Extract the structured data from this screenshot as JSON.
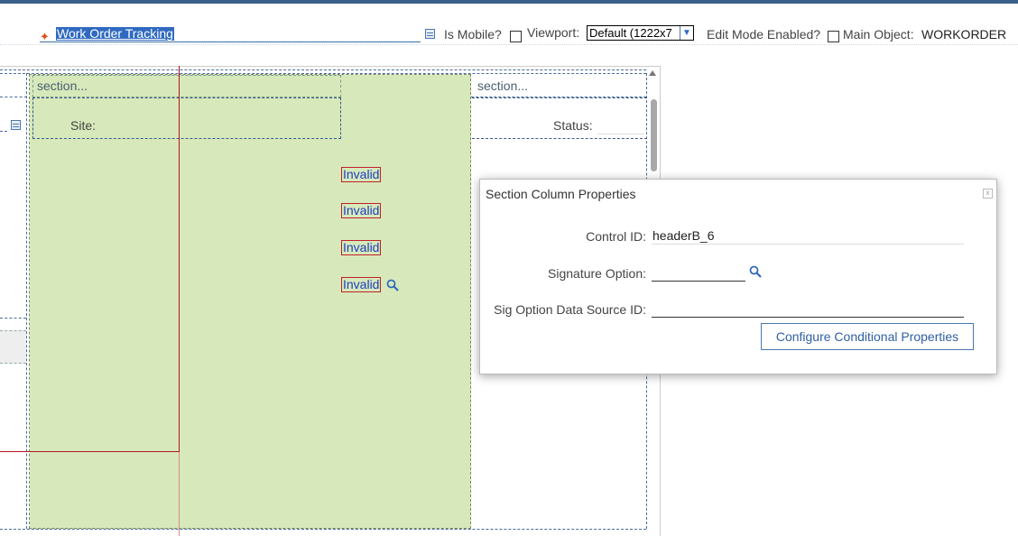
{
  "header": {
    "app_title": "Work Order Tracking",
    "is_mobile_label": "Is Mobile?",
    "viewport_label": "Viewport:",
    "viewport_value": "Default (1222x7",
    "edit_mode_label": "Edit Mode Enabled?",
    "main_object_label": "Main Object:",
    "main_object_value": "WORKORDER"
  },
  "canvas": {
    "section_left_label": "section...",
    "section_right_label": "section...",
    "site_label": "Site:",
    "status_label": "Status:",
    "invalid_items": [
      "Invalid",
      "Invalid",
      "Invalid",
      "Invalid"
    ]
  },
  "dialog": {
    "title": "Section Column Properties",
    "close_glyph": "x",
    "control_id_label": "Control ID:",
    "control_id_value": "headerB_6",
    "signature_option_label": "Signature Option:",
    "signature_option_value": "",
    "sig_option_ds_label": "Sig Option Data Source ID:",
    "sig_option_ds_value": "",
    "configure_button": "Configure Conditional Properties"
  },
  "icons": {
    "star": "required-star-icon",
    "detail": "detail-menu-icon",
    "lookup": "search-icon"
  },
  "colors": {
    "accent": "#2f6ac0",
    "green_column": "#d7e9bb",
    "invalid_border": "#c0202a",
    "top_bar": "#3a5f8a"
  }
}
